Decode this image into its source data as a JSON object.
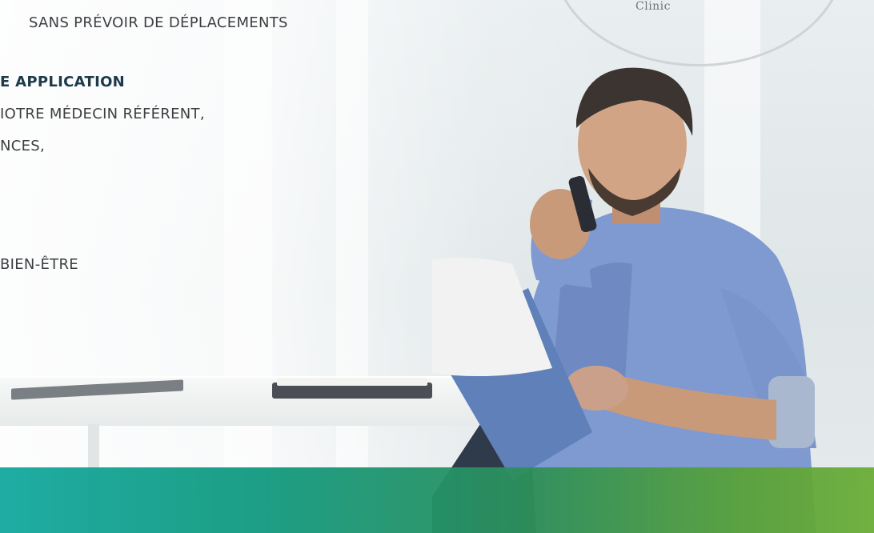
{
  "logo": {
    "text": "Clinic"
  },
  "copy": {
    "line1": "SANS PRÉVOIR DE DÉPLACEMENTS",
    "line2": "E APPLICATION",
    "line3": "IOTRE MÉDECIN RÉFÉRENT,",
    "line4": "NCES,",
    "line5": "BIEN-ÊTRE"
  },
  "colors": {
    "band_start": "#13a89e",
    "band_end": "#6bad38",
    "heading": "#1d3a4a"
  }
}
